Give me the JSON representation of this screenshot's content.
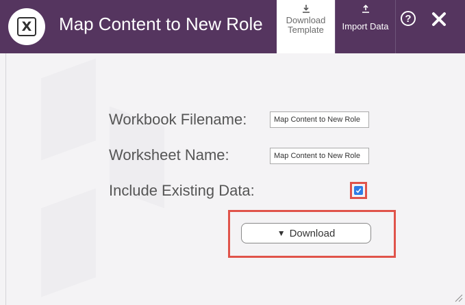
{
  "window": {
    "title": "Map Content to New Role",
    "logo_letter": "X"
  },
  "header": {
    "tabs": [
      {
        "label": "Download Template",
        "label_line1": "Download",
        "label_line2": "Template",
        "icon": "download-icon",
        "active": true
      },
      {
        "label": "Import Data",
        "icon": "upload-icon",
        "active": false
      }
    ],
    "help_label": "?",
    "close_icon": "close-icon"
  },
  "form": {
    "workbook_filename": {
      "label": "Workbook Filename:",
      "value": "Map Content to New Role"
    },
    "worksheet_name": {
      "label": "Worksheet Name:",
      "value": "Map Content to New Role"
    },
    "include_existing_data": {
      "label": "Include Existing Data:",
      "checked": true
    },
    "download_button": {
      "label": "Download",
      "icon": "triangle-down-icon"
    }
  },
  "colors": {
    "header_bg": "#55355f",
    "highlight": "#e0534a",
    "checkbox": "#2e7ce6"
  }
}
